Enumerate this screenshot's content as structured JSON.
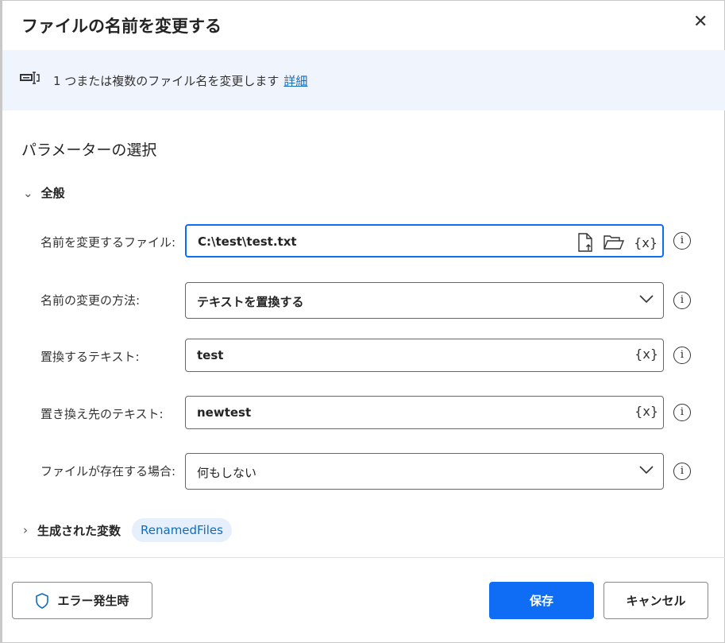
{
  "title": "ファイルの名前を変更する",
  "banner": {
    "text": "1 つまたは複数のファイル名を変更します",
    "link": "詳細"
  },
  "section": "パラメーターの選択",
  "group": "全般",
  "fields": [
    {
      "label": "名前を変更するファイル:",
      "value": "C:\\test\\test.txt"
    },
    {
      "label": "名前の変更の方法:",
      "value": "テキストを置換する"
    },
    {
      "label": "置換するテキスト:",
      "value": "test"
    },
    {
      "label": "置き換え先のテキスト:",
      "value": "newtest"
    },
    {
      "label": "ファイルが存在する場合:",
      "value": "何もしない"
    }
  ],
  "var_symbol": "{x}",
  "info_symbol": "i",
  "vars": {
    "label": "生成された変数",
    "pill": "RenamedFiles"
  },
  "buttons": {
    "error": "エラー発生時",
    "save": "保存",
    "cancel": "キャンセル"
  },
  "colors": {
    "accent": "#0f6cf5"
  }
}
